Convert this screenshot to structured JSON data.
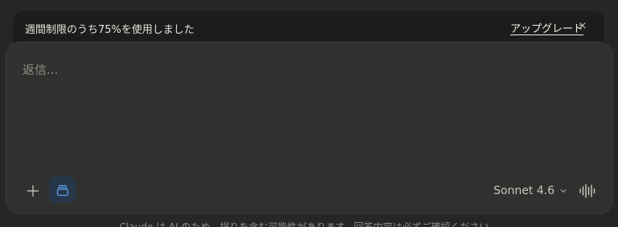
{
  "banner": {
    "message": "週間制限のうち75%を使用しました",
    "upgrade_label": "アップグレード",
    "close_label": "×",
    "close_icon": "close-icon"
  },
  "composer": {
    "placeholder": "返信...",
    "add_icon": "plus-icon",
    "project_icon": "project-icon",
    "model_label": "Sonnet 4.6",
    "model_icon": "chevron-down-icon",
    "voice_icon": "voice-waveform-icon"
  },
  "footer": {
    "disclaimer": "Claude は AI のため、誤りを含む可能性があります。回答内容は必ずご確認ください。"
  },
  "colors": {
    "background": "#262624",
    "banner": "#1c1c1b",
    "composer": "#30302e",
    "project_active": "#27374a",
    "project_icon": "#5d9ded"
  }
}
